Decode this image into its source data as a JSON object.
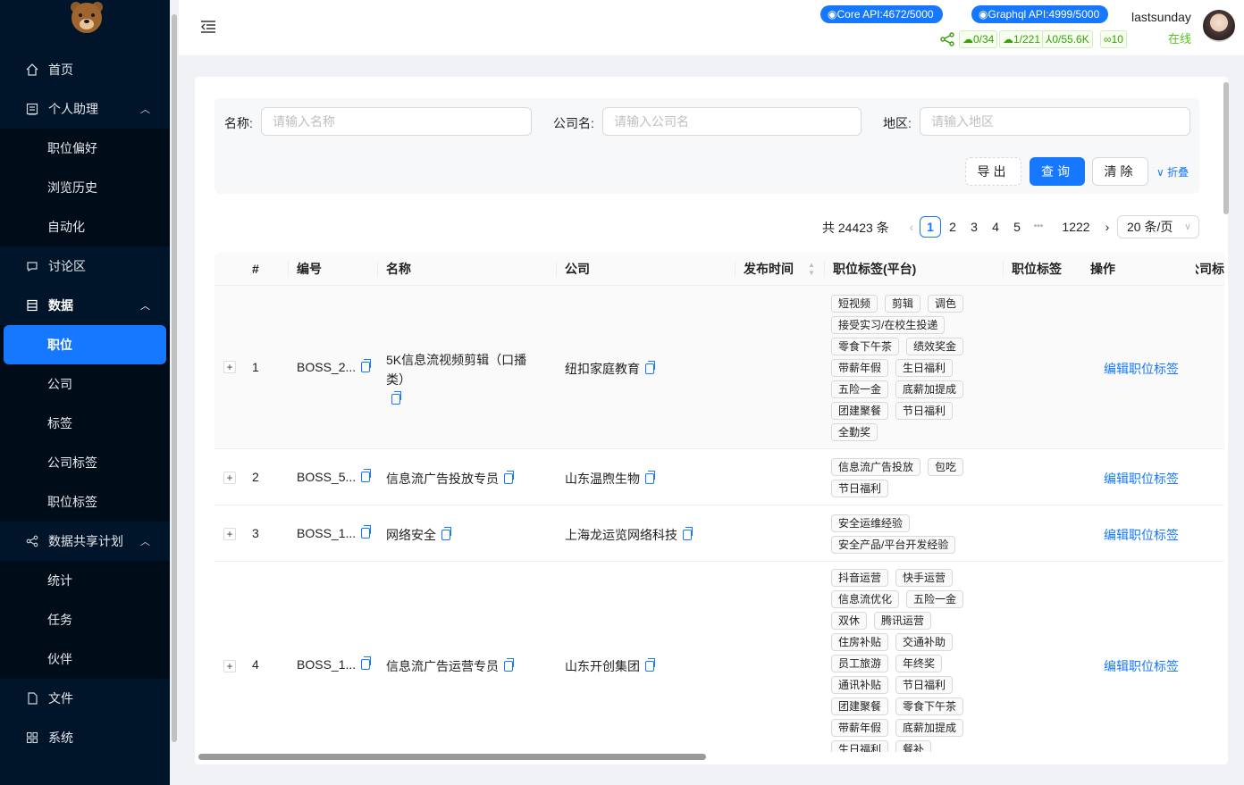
{
  "sidebar": {
    "items": [
      {
        "label": "首页",
        "icon": "home-icon"
      },
      {
        "label": "个人助理",
        "icon": "assistant-icon",
        "expanded": true
      },
      {
        "label": "职位偏好"
      },
      {
        "label": "浏览历史"
      },
      {
        "label": "自动化"
      },
      {
        "label": "讨论区",
        "icon": "discussion-icon"
      },
      {
        "label": "数据",
        "icon": "data-icon",
        "expanded": true
      },
      {
        "label": "职位",
        "active": true
      },
      {
        "label": "公司"
      },
      {
        "label": "标签"
      },
      {
        "label": "公司标签"
      },
      {
        "label": "职位标签"
      },
      {
        "label": "数据共享计划",
        "icon": "share-plan-icon",
        "expanded": true
      },
      {
        "label": "统计"
      },
      {
        "label": "任务"
      },
      {
        "label": "伙伴"
      },
      {
        "label": "文件",
        "icon": "file-icon"
      },
      {
        "label": "系统",
        "icon": "system-icon"
      }
    ]
  },
  "header": {
    "core_api": "Core API:4672/5000",
    "graphql_api": "Graphql API:4999/5000",
    "user_name": "lastsunday",
    "user_status": "在线",
    "stats": [
      "0/34",
      "1/221",
      "0/55.6K",
      "10"
    ]
  },
  "search": {
    "name_label": "名称:",
    "name_placeholder": "请输入名称",
    "company_label": "公司名:",
    "company_placeholder": "请输入公司名",
    "region_label": "地区:",
    "region_placeholder": "请输入地区",
    "export_label": "导出",
    "query_label": "查询",
    "clear_label": "清除",
    "fold_label": "折叠"
  },
  "pagination": {
    "total": "共 24423 条",
    "pages": [
      "1",
      "2",
      "3",
      "4",
      "5"
    ],
    "ellipsis": "•••",
    "last_page": "1222",
    "page_size": "20 条/页",
    "current_page": 1
  },
  "table": {
    "columns": [
      "#",
      "编号",
      "名称",
      "公司",
      "发布时间",
      "职位标签(平台)",
      "职位标签",
      "操作",
      "公司标"
    ],
    "rows": [
      {
        "index": "1",
        "id": "BOSS_2...",
        "name": "5K信息流视频剪辑（口播类）",
        "company": "纽扣家庭教育",
        "tags": [
          "短视频",
          "剪辑",
          "调色",
          "接受实习/在校生投递",
          "零食下午茶",
          "绩效奖金",
          "带薪年假",
          "生日福利",
          "五险一金",
          "底薪加提成",
          "团建聚餐",
          "节日福利",
          "全勤奖"
        ],
        "action": "编辑职位标签"
      },
      {
        "index": "2",
        "id": "BOSS_5...",
        "name": "信息流广告投放专员",
        "company": "山东温煦生物",
        "tags": [
          "信息流广告投放",
          "包吃",
          "节日福利"
        ],
        "action": "编辑职位标签"
      },
      {
        "index": "3",
        "id": "BOSS_1...",
        "name": "网络安全",
        "company": "上海龙运览网络科技",
        "tags": [
          "安全运维经验",
          "安全产品/平台开发经验"
        ],
        "action": "编辑职位标签"
      },
      {
        "index": "4",
        "id": "BOSS_1...",
        "name": "信息流广告运营专员",
        "company": "山东开创集团",
        "tags": [
          "抖音运营",
          "快手运营",
          "信息流优化",
          "五险一金",
          "双休",
          "腾讯运营",
          "住房补贴",
          "交通补助",
          "员工旅游",
          "年终奖",
          "通讯补贴",
          "节日福利",
          "团建聚餐",
          "零食下午茶",
          "带薪年假",
          "底薪加提成",
          "生日福利",
          "餐补"
        ],
        "action": "编辑职位标签"
      }
    ]
  }
}
